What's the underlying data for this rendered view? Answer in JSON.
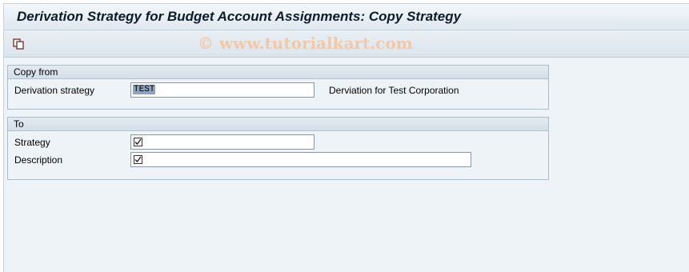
{
  "window": {
    "title": "Derivation Strategy for Budget Account Assignments: Copy Strategy",
    "watermark": "© www.tutorialkart.com"
  },
  "toolbar": {
    "buttons": [
      {
        "icon": "copy-icon"
      }
    ]
  },
  "copy_from": {
    "header": "Copy from",
    "derivation_strategy_label": "Derivation strategy",
    "derivation_strategy_value": "TEST",
    "derivation_strategy_description": "Derviation for Test Corporation"
  },
  "to": {
    "header": "To",
    "strategy_label": "Strategy",
    "strategy_value": "",
    "description_label": "Description",
    "description_value": "",
    "required_icon": "checkbox-required-icon"
  },
  "colors": {
    "background": "#eef3f7",
    "selection": "#8ea3be",
    "watermark": "#f2c9a4"
  }
}
